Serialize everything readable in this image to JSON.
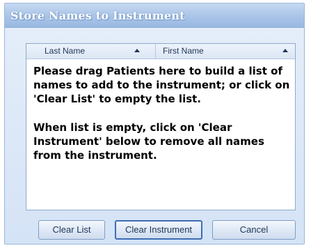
{
  "dialog": {
    "title": "Store Names to Instrument"
  },
  "list": {
    "columns": [
      {
        "label": "Last Name",
        "sort": "ascending"
      },
      {
        "label": "First Name",
        "sort": "ascending"
      }
    ],
    "empty_message": [
      "Please drag Patients here to build a list of names to add to the instrument; or click on 'Clear List' to empty the list.",
      "When list is empty, click on 'Clear Instrument' below to remove all names from the instrument."
    ]
  },
  "buttons": {
    "clear_list": "Clear List",
    "clear_instrument": "Clear Instrument",
    "cancel": "Cancel"
  }
}
